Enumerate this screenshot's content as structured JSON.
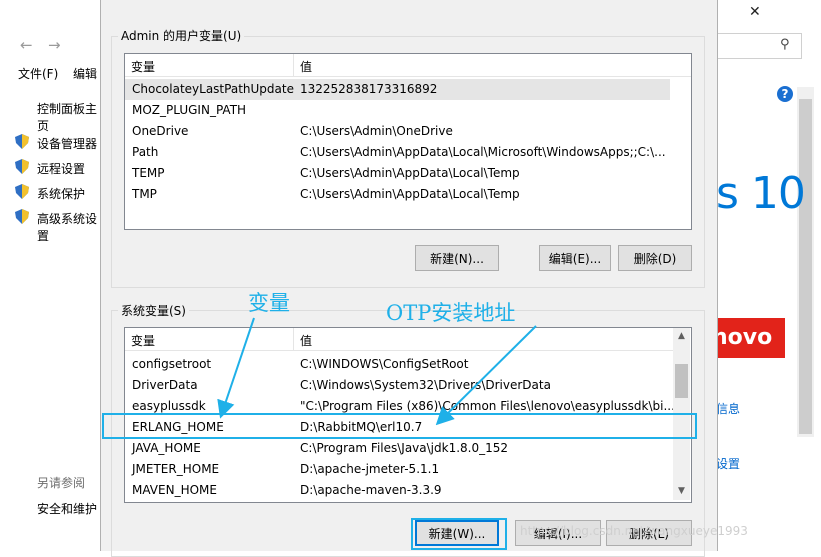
{
  "background": {
    "menu": [
      "文件(F)",
      "编辑"
    ],
    "control_panel_home": "控制面板主页",
    "side_links": [
      "设备管理器",
      "远程设置",
      "系统保护",
      "高级系统设置"
    ],
    "see_also": "另请参阅",
    "security_link": "安全和维护",
    "right_panel": {
      "logo_text": "s 10",
      "brand_text": "novo",
      "link1": "信息",
      "link2": "设置"
    }
  },
  "dialog": {
    "user_vars": {
      "title": "Admin 的用户变量(U)",
      "col_name": "变量",
      "col_value": "值",
      "rows": [
        {
          "name": "ChocolateyLastPathUpdate",
          "value": "132252838173316892"
        },
        {
          "name": "MOZ_PLUGIN_PATH",
          "value": ""
        },
        {
          "name": "OneDrive",
          "value": "C:\\Users\\Admin\\OneDrive"
        },
        {
          "name": "Path",
          "value": "C:\\Users\\Admin\\AppData\\Local\\Microsoft\\WindowsApps;;C:\\..."
        },
        {
          "name": "TEMP",
          "value": "C:\\Users\\Admin\\AppData\\Local\\Temp"
        },
        {
          "name": "TMP",
          "value": "C:\\Users\\Admin\\AppData\\Local\\Temp"
        }
      ],
      "buttons": {
        "new": "新建(N)...",
        "edit": "编辑(E)...",
        "delete": "删除(D)"
      }
    },
    "system_vars": {
      "title": "系统变量(S)",
      "col_name": "变量",
      "col_value": "值",
      "rows": [
        {
          "name": "configsetroot",
          "value": "C:\\WINDOWS\\ConfigSetRoot"
        },
        {
          "name": "DriverData",
          "value": "C:\\Windows\\System32\\Drivers\\DriverData"
        },
        {
          "name": "easyplussdk",
          "value": "\"C:\\Program Files (x86)\\Common Files\\lenovo\\easyplussdk\\bi..."
        },
        {
          "name": "ERLANG_HOME",
          "value": "D:\\RabbitMQ\\erl10.7"
        },
        {
          "name": "JAVA_HOME",
          "value": "C:\\Program Files\\Java\\jdk1.8.0_152"
        },
        {
          "name": "JMETER_HOME",
          "value": "D:\\apache-jmeter-5.1.1"
        },
        {
          "name": "MAVEN_HOME",
          "value": "D:\\apache-maven-3.3.9"
        }
      ],
      "buttons": {
        "new": "新建(W)...",
        "edit": "编辑(I)...",
        "delete": "删除(L)"
      }
    }
  },
  "annotations": {
    "variable_label": "变量",
    "otp_label": "OTP安装地址",
    "color": "#1fb0e8"
  },
  "watermark": "https://blog.csdn.net/wangxueye1993"
}
